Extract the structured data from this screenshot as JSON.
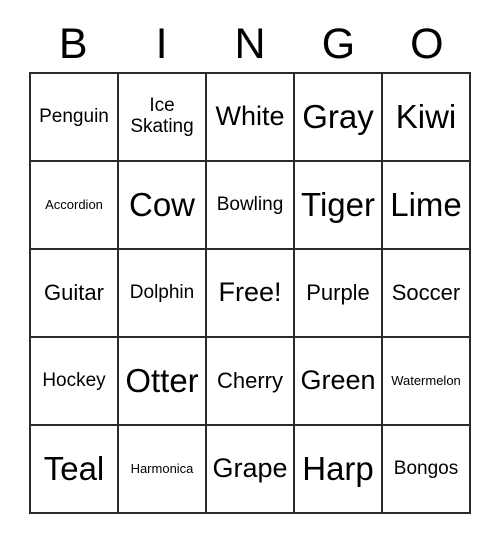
{
  "card": {
    "header": {
      "letters": [
        "B",
        "I",
        "N",
        "G",
        "O"
      ]
    },
    "grid": {
      "rows": 5,
      "columns": 5,
      "border_color": "#2b2b2b",
      "background_color": "#ffffff",
      "text_color": "#000000",
      "cells": [
        {
          "label": "Penguin",
          "size": "md",
          "free": false
        },
        {
          "label": "Ice\nSkating",
          "size": "two-line",
          "free": false
        },
        {
          "label": "White",
          "size": "xl",
          "free": false
        },
        {
          "label": "Gray",
          "size": "xxl",
          "free": false
        },
        {
          "label": "Kiwi",
          "size": "xxl",
          "free": false
        },
        {
          "label": "Accordion",
          "size": "xs",
          "free": false
        },
        {
          "label": "Cow",
          "size": "xxl",
          "free": false
        },
        {
          "label": "Bowling",
          "size": "md",
          "free": false
        },
        {
          "label": "Tiger",
          "size": "xxl",
          "free": false
        },
        {
          "label": "Lime",
          "size": "xxl",
          "free": false
        },
        {
          "label": "Guitar",
          "size": "lg",
          "free": false
        },
        {
          "label": "Dolphin",
          "size": "md",
          "free": false
        },
        {
          "label": "Free!",
          "size": "xl",
          "free": true
        },
        {
          "label": "Purple",
          "size": "lg",
          "free": false
        },
        {
          "label": "Soccer",
          "size": "lg",
          "free": false
        },
        {
          "label": "Hockey",
          "size": "md",
          "free": false
        },
        {
          "label": "Otter",
          "size": "xxl",
          "free": false
        },
        {
          "label": "Cherry",
          "size": "lg",
          "free": false
        },
        {
          "label": "Green",
          "size": "xl",
          "free": false
        },
        {
          "label": "Watermelon",
          "size": "xs",
          "free": false
        },
        {
          "label": "Teal",
          "size": "xxl",
          "free": false
        },
        {
          "label": "Harmonica",
          "size": "xs",
          "free": false
        },
        {
          "label": "Grape",
          "size": "xl",
          "free": false
        },
        {
          "label": "Harp",
          "size": "xxl",
          "free": false
        },
        {
          "label": "Bongos",
          "size": "md",
          "free": false
        }
      ]
    }
  }
}
